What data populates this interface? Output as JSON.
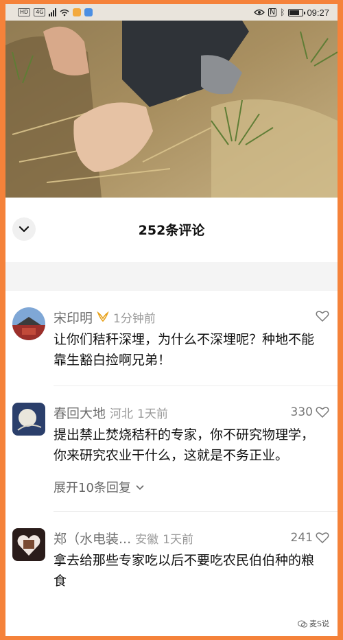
{
  "status_bar": {
    "left_badges": [
      "HD",
      "4G"
    ],
    "time": "09:27",
    "icons": [
      "hd-icon",
      "signal-icon",
      "wifi-icon",
      "weibo-icon",
      "camera-icon",
      "eye-icon",
      "nfc-icon",
      "bluetooth-icon",
      "battery-icon"
    ]
  },
  "comments_panel": {
    "title": "252条评论",
    "collapse_icon": "chevron-down-icon"
  },
  "comments": [
    {
      "name": "宋印明",
      "badge_icon": "vip-badge-icon",
      "location": "",
      "time": "1分钟前",
      "likes": "",
      "text": "让你们秸秆深埋，为什么不深埋呢？种地不能靠生豁白捡啊兄弟！",
      "expand": ""
    },
    {
      "name": "春回大地",
      "location": "河北",
      "time": "1天前",
      "likes": "330",
      "text": "提出禁止焚烧秸秆的专家，你不研究物理学，你来研究农业干什么，这就是不务正业。",
      "expand": "展开10条回复"
    },
    {
      "name": "郑（水电装...",
      "location": "安徽",
      "time": "1天前",
      "likes": "241",
      "text": "拿去给那些专家吃以后不要吃农民伯伯种的粮食",
      "expand": ""
    }
  ],
  "watermark": "麦S说",
  "colors": {
    "frame": "#f5823a",
    "band": "#f4f4f4",
    "badge": "#e8a21b"
  }
}
